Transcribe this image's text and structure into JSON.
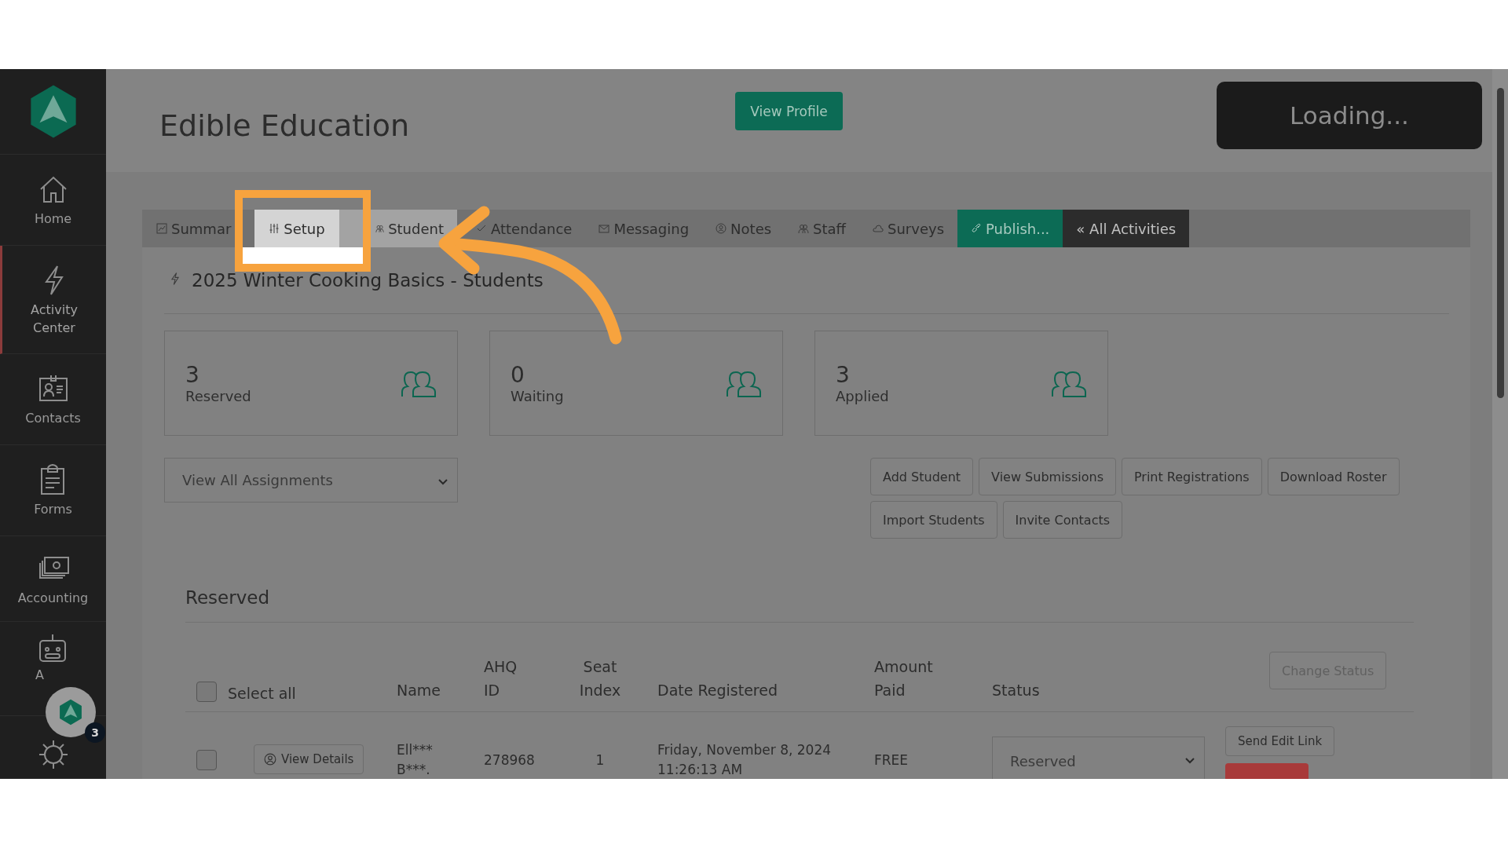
{
  "sidebar": {
    "items": [
      {
        "label": "Home",
        "kind": "home",
        "selected": false
      },
      {
        "label": "Activity Center",
        "kind": "bolt",
        "selected": true
      },
      {
        "label": "Contacts",
        "kind": "contact",
        "selected": false
      },
      {
        "label": "Forms",
        "kind": "clipboard",
        "selected": false
      },
      {
        "label": "Accounting",
        "kind": "money",
        "selected": false
      },
      {
        "label": "A",
        "kind": "robot",
        "selected": false
      },
      {
        "kind": "gear",
        "selected": false
      }
    ],
    "floating_badge": {
      "count": "3"
    }
  },
  "header": {
    "title": "Edible Education",
    "profile_button": "View Profile",
    "loading": "Loading..."
  },
  "tabs": [
    {
      "label": "Summar",
      "kind": "chart",
      "selected": false
    },
    {
      "label": "Setup",
      "kind": "sliders",
      "selected": true
    },
    {
      "label": "Student",
      "kind": "people",
      "selected": false
    },
    {
      "label": "Attendance",
      "kind": "check",
      "selected": false
    },
    {
      "label": "Messaging",
      "kind": "envelope",
      "selected": false
    },
    {
      "label": "Notes",
      "kind": "person",
      "selected": false
    },
    {
      "label": "Staff",
      "kind": "people",
      "selected": false
    },
    {
      "label": "Surveys",
      "kind": "cloud",
      "selected": false
    },
    {
      "label": "Publish...",
      "kind": "publish",
      "selected": false
    },
    {
      "label": "« All Activities",
      "kind": "back",
      "selected": false
    }
  ],
  "activity": {
    "title": "2025 Winter Cooking Basics - Students"
  },
  "stats": [
    {
      "value": "3",
      "label": "Reserved"
    },
    {
      "value": "0",
      "label": "Waiting"
    },
    {
      "value": "3",
      "label": "Applied"
    }
  ],
  "assignment_select": {
    "value": "View All Assignments"
  },
  "actions": [
    "Add Student",
    "View Submissions",
    "Print Registrations",
    "Download Roster",
    "Import Students",
    "Invite Contacts"
  ],
  "section": {
    "title": "Reserved"
  },
  "table": {
    "select_all": {
      "label": "Select all",
      "checked": false
    },
    "columns": [
      "Name",
      "AHQ ID",
      "Seat Index",
      "Date Registered",
      "Amount Paid",
      "Status"
    ],
    "change_status": "Change Status",
    "rows": [
      {
        "checked": false,
        "details": "View Details",
        "name": "Ell*** B***.",
        "id": "278968",
        "seat": "1",
        "date": "Friday, November 8, 2024 11:26:13 AM",
        "amount": "FREE",
        "status": "Reserved",
        "edit_link": "Send Edit Link"
      }
    ]
  }
}
